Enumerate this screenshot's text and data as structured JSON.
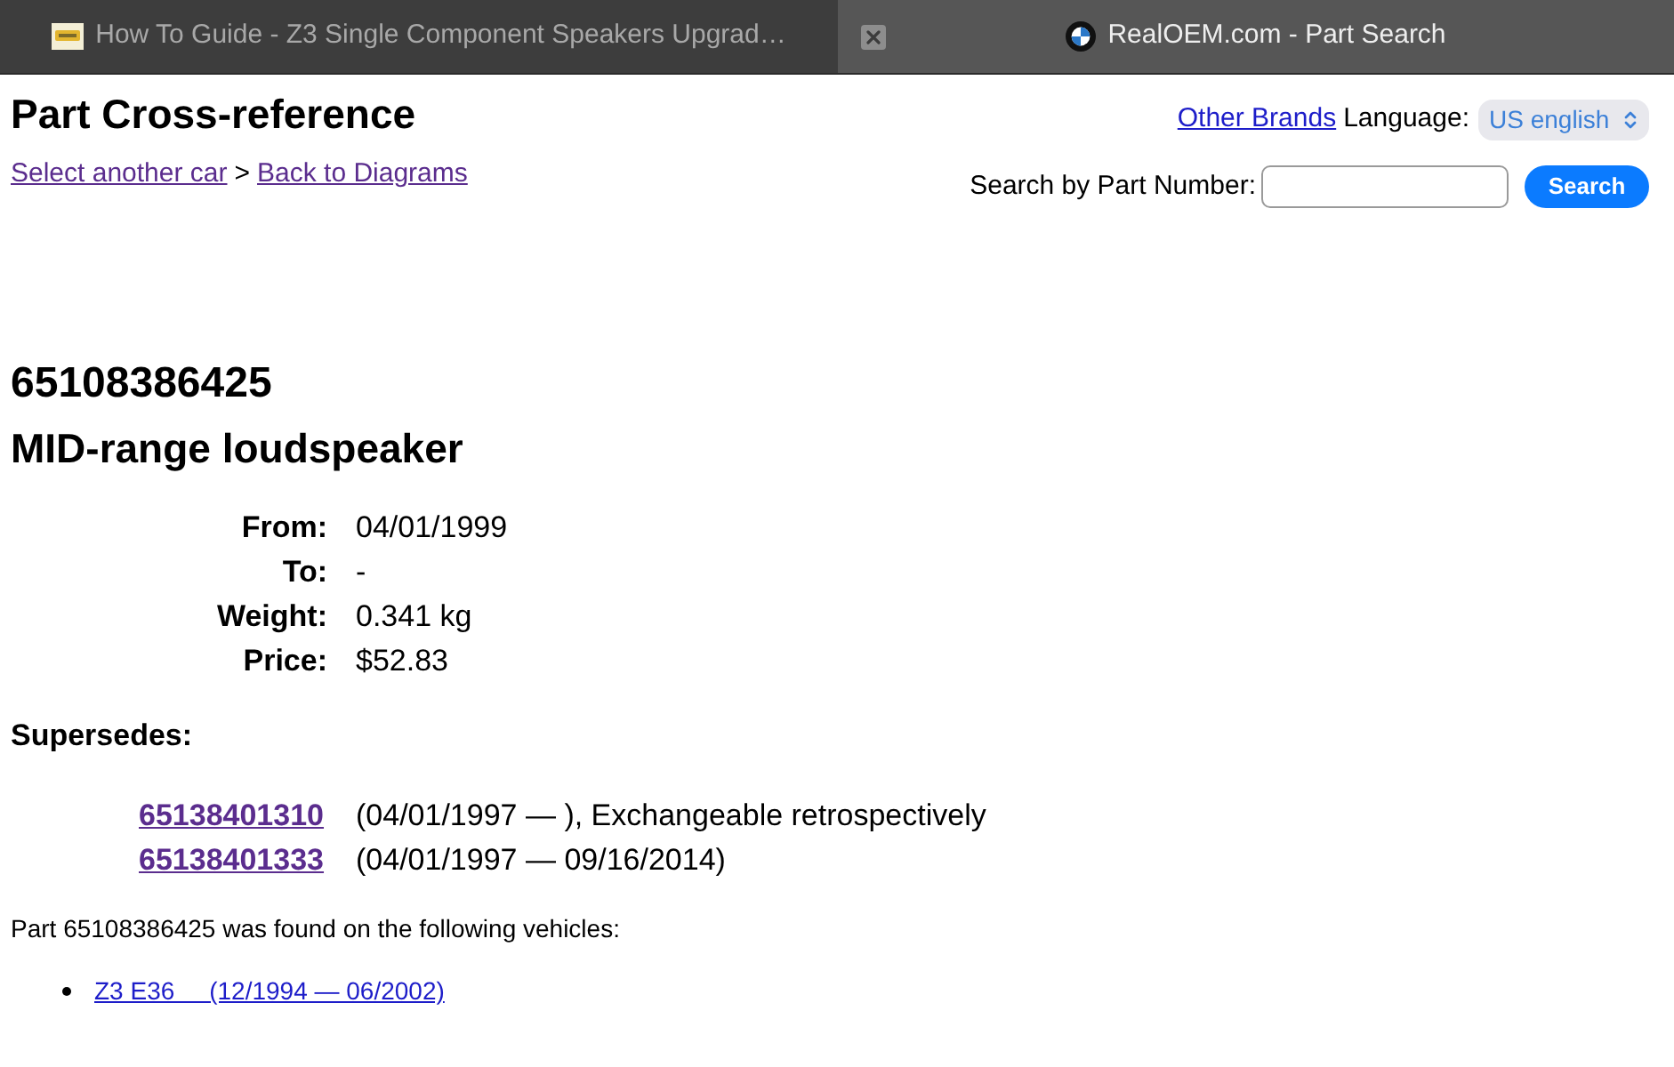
{
  "browser_tabs": [
    {
      "title": "How To Guide - Z3 Single Component Speakers Upgrad…",
      "selected": false
    },
    {
      "title": "RealOEM.com - Part Search",
      "selected": true
    }
  ],
  "header": {
    "title": "Part Cross-reference",
    "breadcrumbs": [
      {
        "kind": "link",
        "label": "Select another car",
        "visited": true
      },
      {
        "kind": "separator",
        "label": ">"
      },
      {
        "kind": "link",
        "label": "Back to Diagrams",
        "visited": true
      }
    ],
    "other_brands": {
      "label": "Other Brands",
      "visited": false
    },
    "language": {
      "label": "Language:",
      "value": "US english"
    },
    "search": {
      "label": "Search by Part Number:",
      "button": "Search"
    }
  },
  "part": {
    "number": "65108386425",
    "name": "MID-range loudspeaker",
    "details": [
      {
        "label": "From:",
        "value": "04/01/1999"
      },
      {
        "label": "To:",
        "value": "-"
      },
      {
        "label": "Weight:",
        "value": "0.341 kg"
      },
      {
        "label": "Price:",
        "value": "$52.83"
      }
    ]
  },
  "supersedes": {
    "heading": "Supersedes:",
    "items": [
      {
        "part": "65138401310",
        "visited": true,
        "note": "(04/01/1997 — ), Exchangeable retrospectively"
      },
      {
        "part": "65138401333",
        "visited": true,
        "note": "(04/01/1997 — 09/16/2014)"
      }
    ]
  },
  "vehicles": {
    "intro": "Part 65108386425 was found on the following vehicles:",
    "items": [
      {
        "label": "Z3 E36     (12/1994 — 06/2002)",
        "visited": false
      }
    ]
  }
}
